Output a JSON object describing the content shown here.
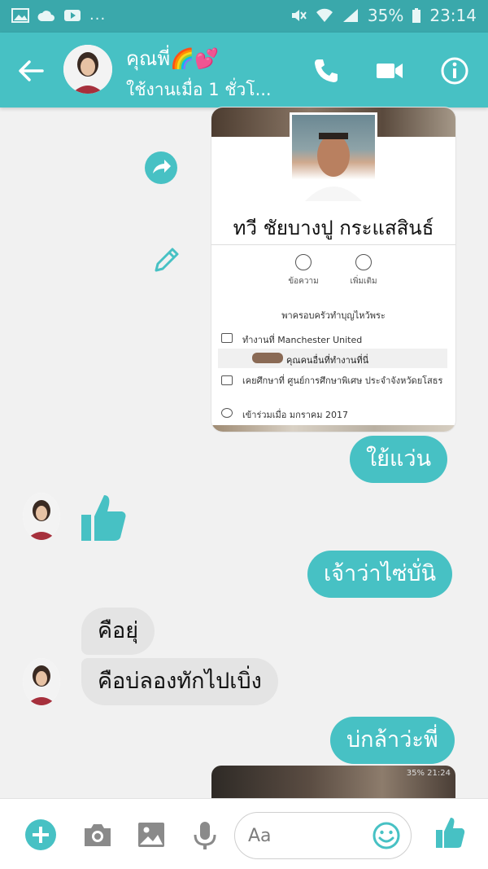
{
  "status_bar": {
    "battery": "35%",
    "time": "23:14",
    "more": "..."
  },
  "header": {
    "contact_name": "คุณพี่🌈💕",
    "status": "ใช้งานเมื่อ 1 ชั่วโ...",
    "icons": [
      "back-arrow-icon",
      "phone-icon",
      "video-icon",
      "info-icon"
    ]
  },
  "shared_profile": {
    "name": "ทวี ชัยบางปู กระแสสินธ์",
    "actions": [
      "ข้อความ",
      "เพิ่มเติม"
    ],
    "motto": "พาครอบครัวทำบุญไหว้พระ",
    "work": "ทำงานที่ Manchester United",
    "coworkers": "คุณคนอื่นที่ทำงานที่นี่",
    "education": "เคยศึกษาที่ ศูนย์การศึกษาพิเศษ ประจำจังหวัดยโสธร",
    "joined": "เข้าร่วมเมื่อ มกราคม 2017"
  },
  "messages": [
    {
      "side": "out",
      "text": "ใย้แว่น"
    },
    {
      "side": "in",
      "type": "like"
    },
    {
      "side": "out",
      "text": "เจ้าว่าไซ่บั่นิ"
    },
    {
      "side": "in",
      "text": "คือยุ่"
    },
    {
      "side": "in",
      "text": "คือบ่ลองทักไปเบิ่ง"
    },
    {
      "side": "out",
      "text": "บ่กล้าว่ะพี่"
    }
  ],
  "image_preview_status": "35% 21:24",
  "composer": {
    "placeholder": "Aa",
    "icons": [
      "plus-icon",
      "camera-icon",
      "gallery-icon",
      "mic-icon",
      "emoji-icon",
      "like-icon"
    ]
  },
  "colors": {
    "accent": "#47c1c4",
    "status_bar": "#3aa8ab",
    "incoming_bubble": "#e4e4e4",
    "background": "#f1f1f1"
  }
}
